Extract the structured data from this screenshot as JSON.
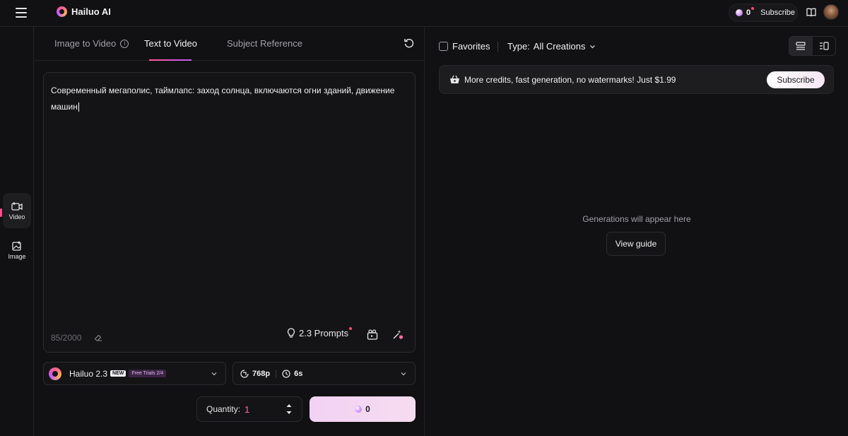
{
  "header": {
    "brand": "Hailuo AI",
    "credits": "0",
    "subscribe_label": "Subscribe"
  },
  "rail": {
    "items": [
      {
        "label": "Video",
        "icon": "video-plus-icon",
        "active": true
      },
      {
        "label": "Image",
        "icon": "image-plus-icon",
        "active": false
      }
    ]
  },
  "tabs": [
    {
      "label": "Image to Video",
      "active": false
    },
    {
      "label": "Text to Video",
      "active": true
    },
    {
      "label": "Subject Reference",
      "active": false
    }
  ],
  "prompt": {
    "text": "Современный мегаполис, таймлапс: заход солнца, включаются огни зданий, движение машин",
    "char_count": "85/2000",
    "prompts_label": "2.3 Prompts"
  },
  "model": {
    "name": "Hailuo 2.3",
    "badge": "NEW",
    "trials": "Free Trials 2/4"
  },
  "settings": {
    "resolution": "768p",
    "duration": "6s"
  },
  "quantity": {
    "label": "Quantity:",
    "value": "1"
  },
  "generate": {
    "cost": "0"
  },
  "filters": {
    "favorites_label": "Favorites",
    "type_label": "Type:",
    "type_value": "All Creations"
  },
  "banner": {
    "text": "More credits, fast generation, no watermarks! Just $1.99",
    "button_label": "Subscribe"
  },
  "empty_state": {
    "text": "Generations will appear here",
    "button_label": "View guide"
  },
  "colors": {
    "background": "#111113",
    "accent_pink": "#ff6aa5",
    "generate_button": "#f2d2f4"
  }
}
